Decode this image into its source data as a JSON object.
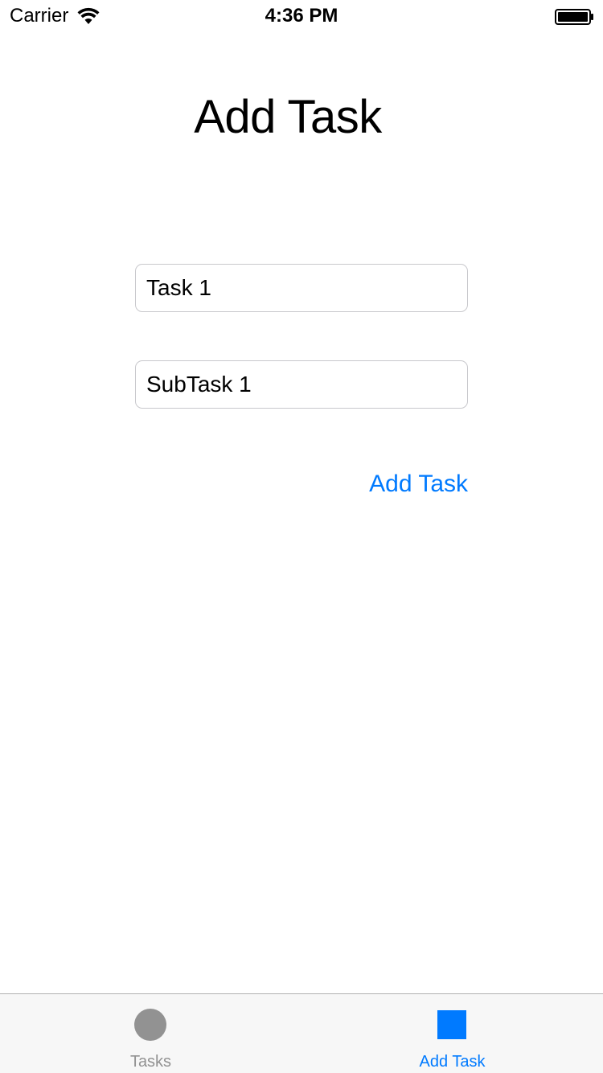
{
  "status_bar": {
    "carrier": "Carrier",
    "time": "4:36 PM",
    "wifi_icon": "wifi-icon",
    "battery_icon": "battery-icon"
  },
  "page": {
    "title": "Add Task"
  },
  "form": {
    "task_field_value": "Task 1",
    "subtask_field_value": "SubTask 1",
    "submit_label": "Add Task"
  },
  "tab_bar": {
    "tabs": [
      {
        "label": "Tasks",
        "icon": "circle-icon",
        "selected": false
      },
      {
        "label": "Add Task",
        "icon": "square-icon",
        "selected": true
      }
    ]
  },
  "colors": {
    "accent": "#007aff",
    "inactive_tab": "#929292",
    "field_border": "#c8c8cc",
    "tab_bar_bg": "#f7f7f7"
  }
}
